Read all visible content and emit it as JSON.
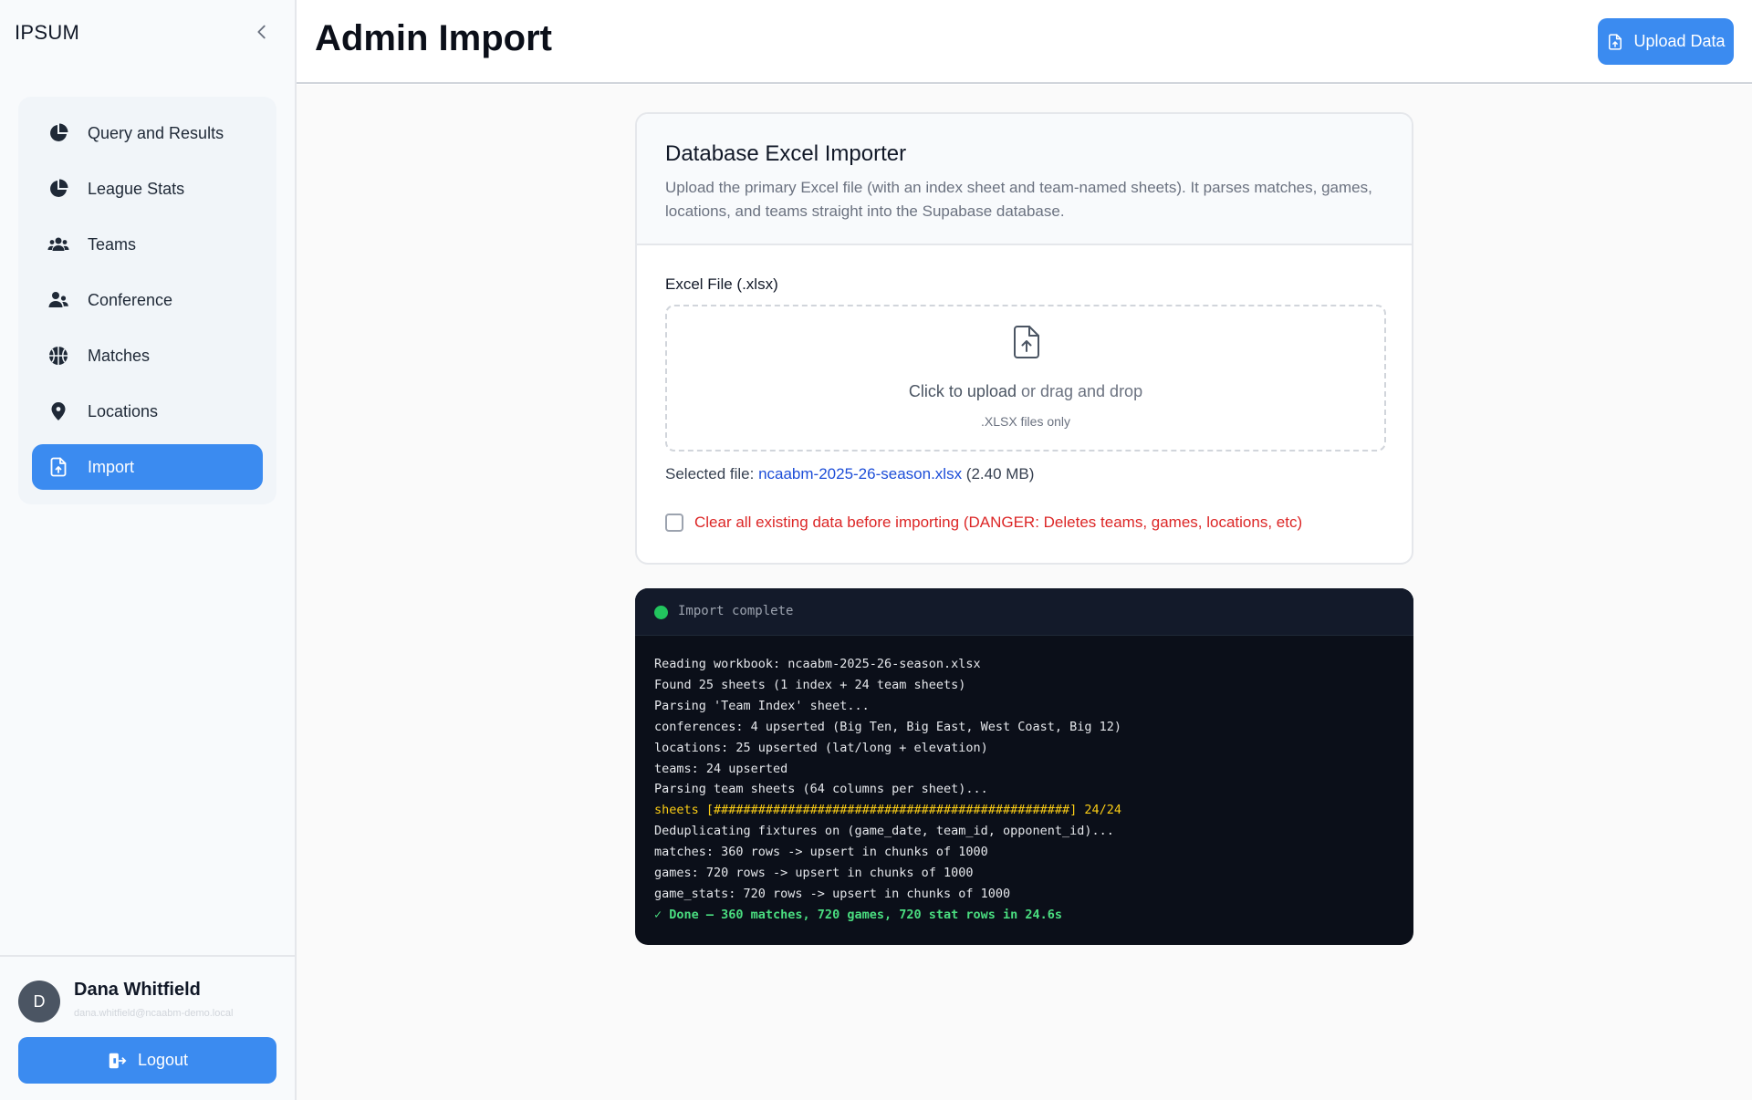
{
  "app": {
    "brand": "IPSUM"
  },
  "sidebar": {
    "items": [
      {
        "label": "Query and Results",
        "icon": "pie-chart-icon"
      },
      {
        "label": "League Stats",
        "icon": "pie-chart-icon"
      },
      {
        "label": "Teams",
        "icon": "users-icon"
      },
      {
        "label": "Conference",
        "icon": "user-group-icon"
      },
      {
        "label": "Matches",
        "icon": "basketball-icon"
      },
      {
        "label": "Locations",
        "icon": "map-pin-icon"
      },
      {
        "label": "Import",
        "icon": "file-upload-icon",
        "active": true
      }
    ]
  },
  "user": {
    "initial": "D",
    "name": "Dana Whitfield",
    "email": "dana.whitfield@ncaabm-demo.local",
    "logout_label": "Logout"
  },
  "header": {
    "title": "Admin Import",
    "upload_label": "Upload Data"
  },
  "importer": {
    "title": "Database Excel Importer",
    "description": "Upload the primary Excel file (with an index sheet and team-named sheets). It parses matches, games, locations, and teams straight into the Supabase database.",
    "field_label": "Excel File (.xlsx)",
    "dropzone_cta": "Click to upload",
    "dropzone_rest": " or drag and drop",
    "dropzone_hint": ".XLSX files only",
    "selected_prefix": "Selected file: ",
    "selected_file": "ncaabm-2025-26-season.xlsx",
    "selected_size": " (2.40 MB)",
    "clear_checked": false,
    "clear_label": "Clear all existing data before importing (DANGER: Deletes teams, games, locations, etc)"
  },
  "log": {
    "status": "Import complete",
    "colors": {
      "status_dot": "#22c55e",
      "progress": "#facc15",
      "done": "#4ade80",
      "danger": "#dc2626",
      "accent": "#3b8bf0"
    },
    "lines": [
      {
        "text": "Reading workbook: ncaabm-2025-26-season.xlsx",
        "kind": "normal"
      },
      {
        "text": "Found 25 sheets (1 index + 24 team sheets)",
        "kind": "normal"
      },
      {
        "text": "Parsing 'Team Index' sheet...",
        "kind": "normal"
      },
      {
        "text": "conferences: 4 upserted (Big Ten, Big East, West Coast, Big 12)",
        "kind": "normal"
      },
      {
        "text": "locations: 25 upserted (lat/long + elevation)",
        "kind": "normal"
      },
      {
        "text": "teams: 24 upserted",
        "kind": "normal"
      },
      {
        "text": "Parsing team sheets (64 columns per sheet)...",
        "kind": "normal"
      },
      {
        "text": "sheets [################################################] 24/24",
        "kind": "warn"
      },
      {
        "text": "Deduplicating fixtures on (game_date, team_id, opponent_id)...",
        "kind": "normal"
      },
      {
        "text": "matches: 360 rows -> upsert in chunks of 1000",
        "kind": "normal"
      },
      {
        "text": "games: 720 rows -> upsert in chunks of 1000",
        "kind": "normal"
      },
      {
        "text": "game_stats: 720 rows -> upsert in chunks of 1000",
        "kind": "normal"
      },
      {
        "text": "✓ Done — 360 matches, 720 games, 720 stat rows in 24.6s",
        "kind": "ok"
      }
    ]
  }
}
